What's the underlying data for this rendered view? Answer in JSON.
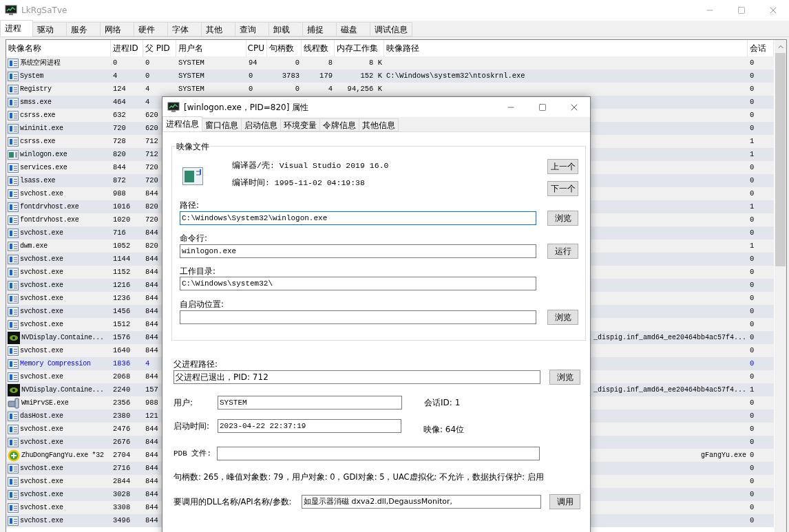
{
  "window": {
    "title": "LkRgSaTve"
  },
  "tabs": [
    {
      "label": "进程",
      "selected": true
    },
    {
      "label": "驱动",
      "selected": false
    },
    {
      "label": "服务",
      "selected": false
    },
    {
      "label": "网络",
      "selected": false
    },
    {
      "label": "硬件",
      "selected": false
    },
    {
      "label": "字体",
      "selected": false
    },
    {
      "label": "其他",
      "selected": false
    },
    {
      "label": "查询",
      "selected": false
    },
    {
      "label": "卸载",
      "selected": false
    },
    {
      "label": "捕捉",
      "selected": false
    },
    {
      "label": "磁盘",
      "selected": false
    },
    {
      "label": "调试信息",
      "selected": false
    }
  ],
  "table": {
    "columns": [
      "映像名称",
      "进程ID",
      "父 PID",
      "用户名",
      "CPU",
      "句柄数",
      "线程数",
      "内存工作集",
      "映像路径",
      "会话"
    ],
    "rows": [
      {
        "kind": "app",
        "highlighted": false,
        "name": "系统空闲进程",
        "pid": "0",
        "ppid": "0",
        "user": "SYSTEM",
        "cpu": "94",
        "handles": "0",
        "threads": "8",
        "mem": "8 K",
        "session": "0"
      },
      {
        "kind": "app",
        "highlighted": false,
        "name": "System",
        "pid": "4",
        "ppid": "0",
        "user": "SYSTEM",
        "cpu": "0",
        "handles": "3783",
        "threads": "179",
        "mem": "152 K",
        "path": "C:\\Windows\\system32\\ntoskrnl.exe",
        "session": "0"
      },
      {
        "kind": "app",
        "highlighted": false,
        "name": "Registry",
        "pid": "124",
        "ppid": "4",
        "user": "SYSTEM",
        "cpu": "0",
        "handles": "0",
        "threads": "4",
        "mem": "94,256 K",
        "session": "0"
      },
      {
        "kind": "app",
        "highlighted": false,
        "name": "smss.exe",
        "pid": "464",
        "ppid": "4",
        "session": "0"
      },
      {
        "kind": "app",
        "highlighted": false,
        "name": "csrss.exe",
        "pid": "632",
        "ppid": "620",
        "session": "0"
      },
      {
        "kind": "app",
        "highlighted": false,
        "name": "wininit.exe",
        "pid": "720",
        "ppid": "620",
        "session": "0"
      },
      {
        "kind": "app",
        "highlighted": false,
        "name": "csrss.exe",
        "pid": "728",
        "ppid": "712",
        "session": "1"
      },
      {
        "kind": "window",
        "highlighted": false,
        "name": "winlogon.exe",
        "pid": "820",
        "ppid": "712",
        "session": "1"
      },
      {
        "kind": "app",
        "highlighted": false,
        "name": "services.exe",
        "pid": "844",
        "ppid": "720",
        "session": "0"
      },
      {
        "kind": "app",
        "highlighted": false,
        "name": "lsass.exe",
        "pid": "872",
        "ppid": "720",
        "session": "0"
      },
      {
        "kind": "app",
        "highlighted": false,
        "name": "svchost.exe",
        "pid": "988",
        "ppid": "844",
        "session": "0"
      },
      {
        "kind": "app",
        "highlighted": false,
        "name": "fontdrvhost.exe",
        "pid": "1016",
        "ppid": "820",
        "session": "1"
      },
      {
        "kind": "app",
        "highlighted": false,
        "name": "fontdrvhost.exe",
        "pid": "1020",
        "ppid": "720",
        "session": "0"
      },
      {
        "kind": "app",
        "highlighted": false,
        "name": "svchost.exe",
        "pid": "716",
        "ppid": "844",
        "session": "0"
      },
      {
        "kind": "app",
        "highlighted": false,
        "name": "dwm.exe",
        "pid": "1052",
        "ppid": "820",
        "session": "1"
      },
      {
        "kind": "app",
        "highlighted": false,
        "name": "svchost.exe",
        "pid": "1144",
        "ppid": "844",
        "session": "0"
      },
      {
        "kind": "app",
        "highlighted": false,
        "name": "svchost.exe",
        "pid": "1152",
        "ppid": "844",
        "session": "0"
      },
      {
        "kind": "app",
        "highlighted": false,
        "name": "svchost.exe",
        "pid": "1216",
        "ppid": "844",
        "session": "0"
      },
      {
        "kind": "app",
        "highlighted": false,
        "name": "svchost.exe",
        "pid": "1236",
        "ppid": "844",
        "session": "0"
      },
      {
        "kind": "app",
        "highlighted": false,
        "name": "svchost.exe",
        "pid": "1456",
        "ppid": "844",
        "session": "0"
      },
      {
        "kind": "app",
        "highlighted": false,
        "name": "svchost.exe",
        "pid": "1512",
        "ppid": "844",
        "session": "0"
      },
      {
        "kind": "chip",
        "highlighted": false,
        "name": "NVDisplay.Containe...",
        "pid": "1576",
        "ppid": "844",
        "path": "_dispig.inf_amd64_ee20464bb4ac57f4...",
        "session": "0"
      },
      {
        "kind": "app",
        "highlighted": false,
        "name": "svchost.exe",
        "pid": "1640",
        "ppid": "844",
        "session": "0"
      },
      {
        "kind": "app",
        "highlighted": true,
        "name": "Memory Compression",
        "pid": "1836",
        "ppid": "4",
        "session": "0"
      },
      {
        "kind": "app",
        "highlighted": false,
        "name": "svchost.exe",
        "pid": "2068",
        "ppid": "844",
        "session": "0"
      },
      {
        "kind": "chip",
        "highlighted": false,
        "name": "NVDisplay.Containe...",
        "pid": "2240",
        "ppid": "157",
        "path": "_dispig.inf_amd64_ee20464bb4ac57f4...",
        "session": "1"
      },
      {
        "kind": "device",
        "highlighted": false,
        "name": "WmiPrvSE.exe",
        "pid": "2356",
        "ppid": "988",
        "session": "0"
      },
      {
        "kind": "app",
        "highlighted": false,
        "name": "dasHost.exe",
        "pid": "2380",
        "ppid": "121",
        "session": "0"
      },
      {
        "kind": "app",
        "highlighted": false,
        "name": "svchost.exe",
        "pid": "2476",
        "ppid": "844",
        "session": "0"
      },
      {
        "kind": "app",
        "highlighted": false,
        "name": "svchost.exe",
        "pid": "2676",
        "ppid": "844",
        "session": "0"
      },
      {
        "kind": "plus",
        "highlighted": false,
        "name": "ZhuDongFangYu.exe *32",
        "pid": "2704",
        "ppid": "844",
        "path": "gFangYu.exe",
        "session": "0"
      },
      {
        "kind": "app",
        "highlighted": false,
        "name": "svchost.exe",
        "pid": "2716",
        "ppid": "844",
        "session": "0"
      },
      {
        "kind": "app",
        "highlighted": false,
        "name": "svchost.exe",
        "pid": "2844",
        "ppid": "844",
        "session": "0"
      },
      {
        "kind": "app",
        "highlighted": false,
        "name": "svchost.exe",
        "pid": "3028",
        "ppid": "844",
        "session": "0"
      },
      {
        "kind": "app",
        "highlighted": false,
        "name": "svchost.exe",
        "pid": "3308",
        "ppid": "844",
        "session": "0"
      },
      {
        "kind": "app",
        "highlighted": false,
        "name": "svchost.exe",
        "pid": "3496",
        "ppid": "844",
        "session": "0"
      }
    ]
  },
  "dialog": {
    "title": "[winlogon.exe，PID=820] 属性",
    "tabs": [
      {
        "label": "进程信息",
        "selected": true
      },
      {
        "label": "窗口信息",
        "selected": false
      },
      {
        "label": "启动信息",
        "selected": false
      },
      {
        "label": "环境变量",
        "selected": false
      },
      {
        "label": "令牌信息",
        "selected": false
      },
      {
        "label": "其他信息",
        "selected": false
      }
    ],
    "group": {
      "title": "映像文件",
      "compiler": "编译器/壳: Visual Studio 2019 16.0",
      "compile_time": "编译时间: 1995-11-02 04:19:38",
      "nav_buttons": [
        "上一个",
        "下一个"
      ],
      "fields": [
        {
          "label": "路径:",
          "value": "C:\\Windows\\System32\\winlogon.exe",
          "focused": true,
          "button": "浏览"
        },
        {
          "label": "命令行:",
          "value": "winlogon.exe",
          "focused": false,
          "button": "运行"
        },
        {
          "label": "工作目录:",
          "value": "C:\\Windows\\system32\\",
          "focused": false
        },
        {
          "label": "自启动位置:",
          "focused": false,
          "button": "浏览"
        }
      ]
    },
    "parent": {
      "label": "父进程路径:",
      "value": "父进程已退出，PID: 712",
      "button": "浏览"
    },
    "user": {
      "label": "用户:",
      "value": "SYSTEM"
    },
    "session": "会话ID: 1",
    "start": {
      "label": "启动时间:",
      "value": "2023-04-22 22:37:19"
    },
    "image_bits": "映像: 64位",
    "pdb": {
      "label": "PDB 文件:"
    },
    "stats": "句柄数: 265，峰值对象数: 79，用户对象: 0，GDI对象: 5，UAC虚拟化: 不允许，数据执行保护: 启用",
    "dll": {
      "label": "要调用的DLL名称/API名称/参数:",
      "value": "如显示器消磁 dxva2.dll,DegaussMonitor,",
      "button": "调用"
    }
  }
}
